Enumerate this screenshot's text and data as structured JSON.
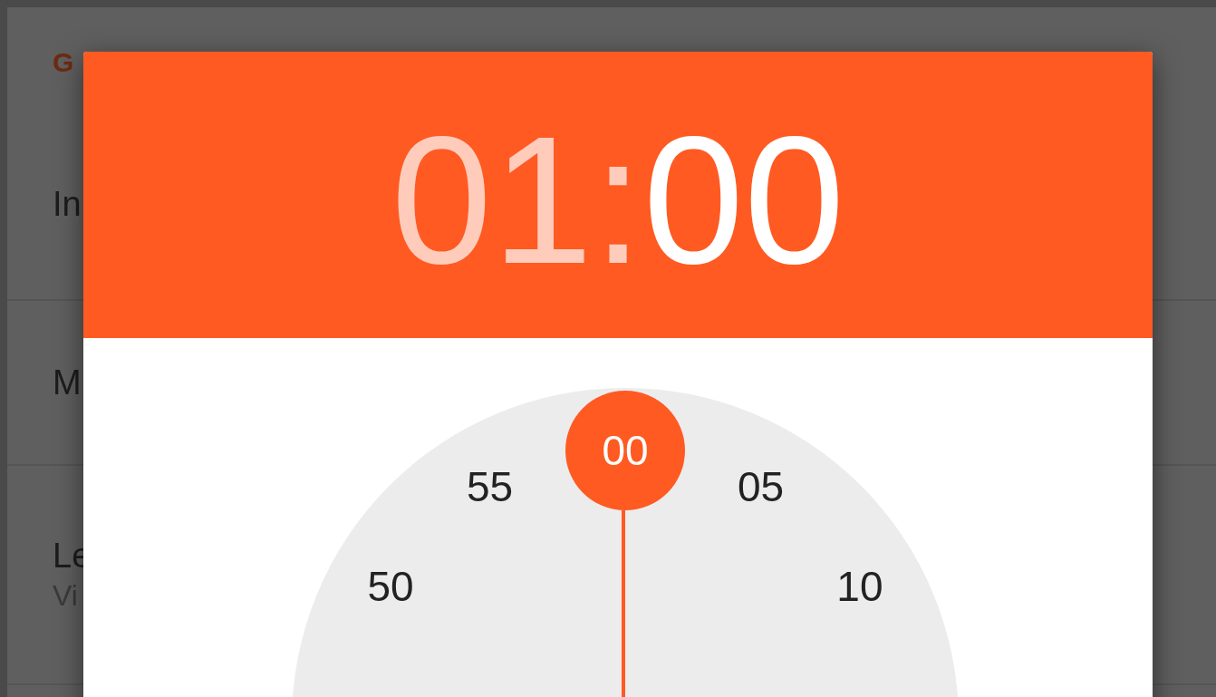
{
  "background_list": {
    "section_header": "G",
    "rows": [
      {
        "title": "In"
      },
      {
        "title": "M"
      },
      {
        "title": "Le",
        "subtitle": "Vi"
      }
    ]
  },
  "dialog": {
    "time": {
      "hours": "01",
      "separator": ":",
      "minutes": "00",
      "hours_selected": false,
      "minutes_selected": true
    },
    "clock": {
      "numbers": [
        {
          "label": "50",
          "selected": false
        },
        {
          "label": "55",
          "selected": false
        },
        {
          "label": "00",
          "selected": true
        },
        {
          "label": "05",
          "selected": false
        },
        {
          "label": "10",
          "selected": false
        }
      ]
    }
  }
}
